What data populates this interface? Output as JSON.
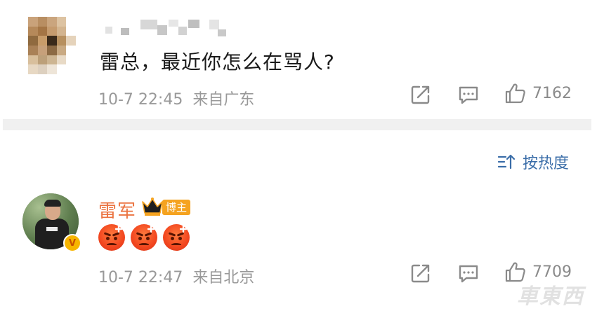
{
  "comment1": {
    "author_masked": "",
    "text": "雷总，最近你怎么在骂人?",
    "time": "10-7 22:45",
    "location": "来自广东",
    "likes": "7162"
  },
  "sort": {
    "label": "按热度",
    "icon": "sort-icon"
  },
  "comment2": {
    "author": "雷军",
    "badge": "博主",
    "verified_badge": "V",
    "emoji_count": 3,
    "emoji": "angry-face",
    "time": "10-7 22:47",
    "location": "来自北京",
    "likes": "7709"
  },
  "watermark": "車東西",
  "colors": {
    "author_name": "#eb7340",
    "sort_link": "#3a6da8",
    "meta_gray": "#999999",
    "badge_bg": "#f5a320"
  }
}
